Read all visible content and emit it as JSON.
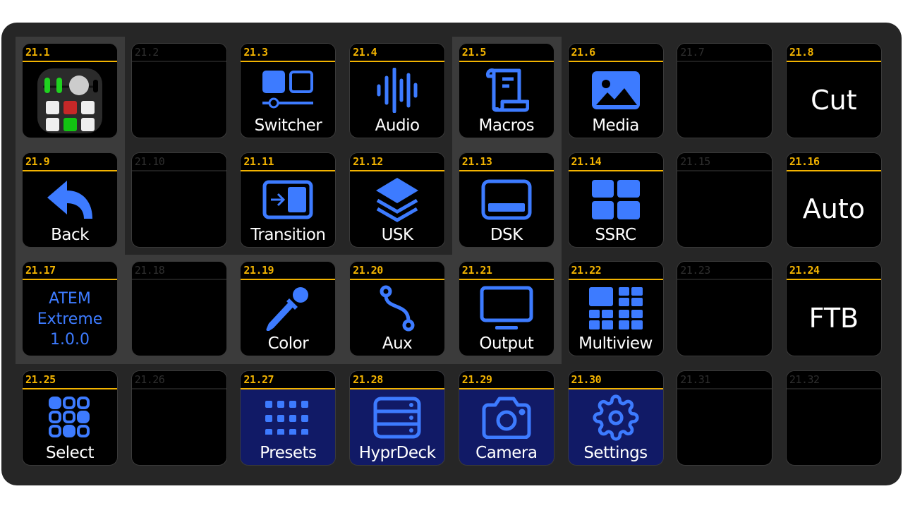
{
  "page_number": "21",
  "colors": {
    "accent": "#3d7bff",
    "header_line": "#f2b300",
    "navy_button": "#111a66",
    "panel": "#262626"
  },
  "highlighted_cells": [
    [
      0,
      0
    ],
    [
      1,
      0
    ],
    [
      2,
      0
    ],
    [
      0,
      4
    ],
    [
      1,
      4
    ],
    [
      2,
      4
    ],
    [
      2,
      1
    ],
    [
      2,
      2
    ],
    [
      2,
      3
    ]
  ],
  "buttons": [
    {
      "id": "21.1",
      "label": "",
      "icon": "mixer-app-icon"
    },
    {
      "id": "21.2",
      "empty": true
    },
    {
      "id": "21.3",
      "label": "Switcher",
      "icon": "switcher-icon"
    },
    {
      "id": "21.4",
      "label": "Audio",
      "icon": "audio-waveform-icon"
    },
    {
      "id": "21.5",
      "label": "Macros",
      "icon": "scroll-icon"
    },
    {
      "id": "21.6",
      "label": "Media",
      "icon": "image-icon"
    },
    {
      "id": "21.7",
      "empty": true
    },
    {
      "id": "21.8",
      "big": "Cut"
    },
    {
      "id": "21.9",
      "label": "Back",
      "icon": "back-arrow-icon"
    },
    {
      "id": "21.10",
      "empty": true
    },
    {
      "id": "21.11",
      "label": "Transition",
      "icon": "transition-icon"
    },
    {
      "id": "21.12",
      "label": "USK",
      "icon": "layers-icon"
    },
    {
      "id": "21.13",
      "label": "DSK",
      "icon": "dsk-icon"
    },
    {
      "id": "21.14",
      "label": "SSRC",
      "icon": "grid-2x2-icon"
    },
    {
      "id": "21.15",
      "empty": true
    },
    {
      "id": "21.16",
      "big": "Auto"
    },
    {
      "id": "21.17",
      "blue": [
        "ATEM",
        "Extreme",
        "1.0.0"
      ]
    },
    {
      "id": "21.18",
      "empty": true
    },
    {
      "id": "21.19",
      "label": "Color",
      "icon": "eyedropper-icon"
    },
    {
      "id": "21.20",
      "label": "Aux",
      "icon": "route-icon"
    },
    {
      "id": "21.21",
      "label": "Output",
      "icon": "monitor-icon"
    },
    {
      "id": "21.22",
      "label": "Multiview",
      "icon": "multiview-icon"
    },
    {
      "id": "21.23",
      "empty": true
    },
    {
      "id": "21.24",
      "big": "FTB"
    },
    {
      "id": "21.25",
      "label": "Select",
      "icon": "select-grid-icon"
    },
    {
      "id": "21.26",
      "empty": true
    },
    {
      "id": "21.27",
      "label": "Presets",
      "icon": "dots-grid-icon",
      "navy": true
    },
    {
      "id": "21.28",
      "label": "HyprDeck",
      "icon": "server-icon",
      "navy": true
    },
    {
      "id": "21.29",
      "label": "Camera",
      "icon": "camera-icon",
      "navy": true
    },
    {
      "id": "21.30",
      "label": "Settings",
      "icon": "gear-icon",
      "navy": true
    },
    {
      "id": "21.31",
      "empty": true
    },
    {
      "id": "21.32",
      "empty": true
    }
  ]
}
